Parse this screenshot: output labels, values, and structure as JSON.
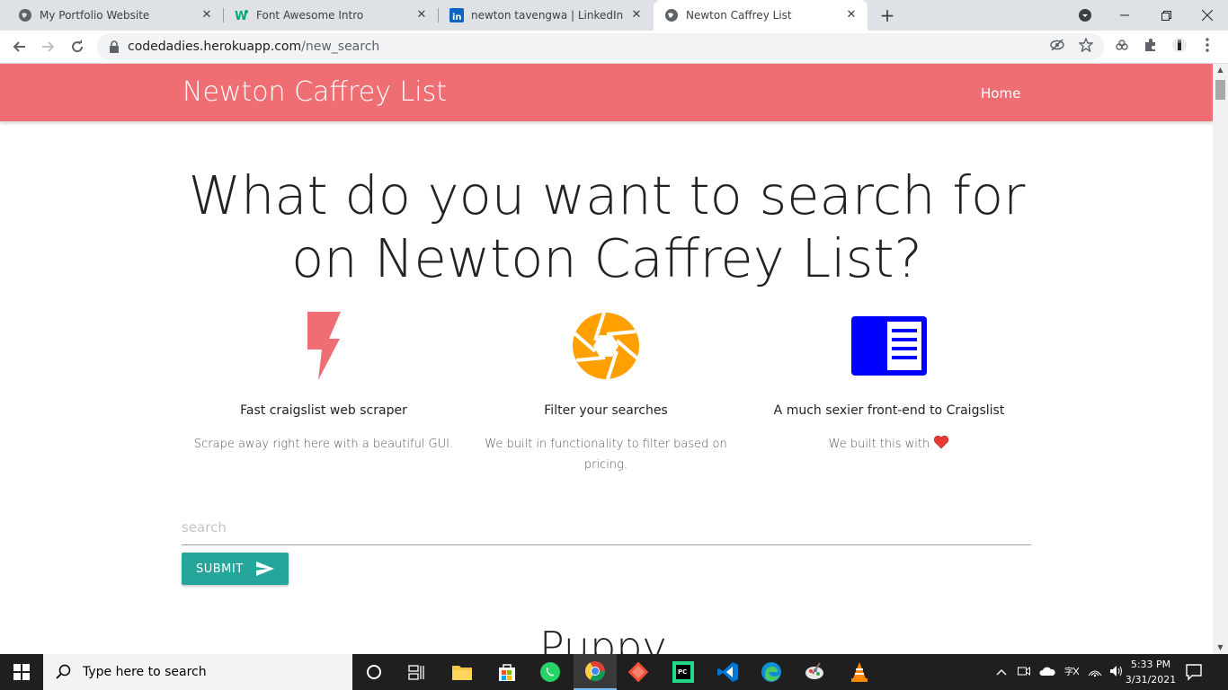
{
  "browser": {
    "tabs": [
      {
        "title": "My Portfolio Website",
        "icon": "globe-icon"
      },
      {
        "title": "Font Awesome Intro",
        "icon": "w3-icon"
      },
      {
        "title": "newton tavengwa | LinkedIn",
        "icon": "linkedin-icon"
      },
      {
        "title": "Newton Caffrey List",
        "icon": "globe-icon",
        "active": true
      }
    ],
    "new_tab": "+",
    "url_host": "codedadies.herokuapp.com",
    "url_path": "/new_search"
  },
  "site": {
    "brand": "Newton Caffrey List",
    "nav_home": "Home",
    "brand_color": "#ef6e73",
    "headline_line1": "What do you want to search for",
    "headline_line2": "on Newton Caffrey List?",
    "features": [
      {
        "icon": "bolt-icon",
        "title": "Fast craigslist web scraper",
        "desc": "Scrape away right here with a beautiful GUI.",
        "color": "#ef6e73"
      },
      {
        "icon": "camera-aperture-icon",
        "title": "Filter your searches",
        "desc": "We built in functionality to filter based on pricing.",
        "color": "#ffa000"
      },
      {
        "icon": "chrome-reader-icon",
        "title": "A much sexier front-end to Craigslist",
        "desc": "We built this with",
        "color": "#0000ff"
      }
    ],
    "search_placeholder": "search",
    "submit_label": "SUBMIT",
    "submit_color": "#26a69a",
    "section_heading": "Puppy"
  },
  "taskbar": {
    "search_label": "Type here to search",
    "time": "5:33 PM",
    "date": "3/31/2021"
  }
}
